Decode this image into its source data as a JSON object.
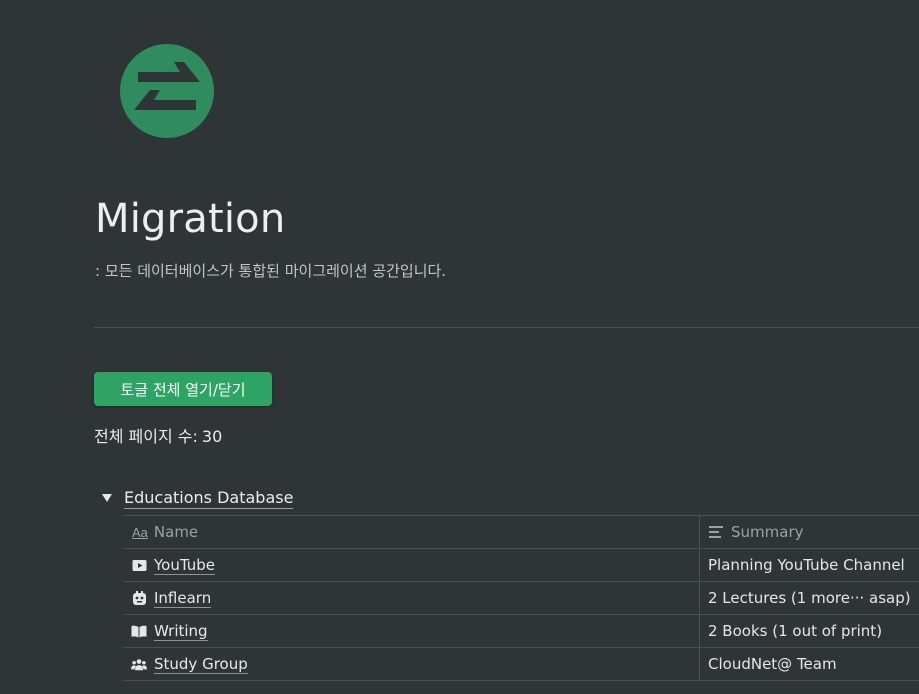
{
  "page": {
    "title": "Migration",
    "subtitle": ": 모든 데이터베이스가 통합된 마이그레이션 공간입니다.",
    "toggle_button_label": "토글 전체 열기/닫기",
    "page_count_label": "전체 페이지 수:",
    "page_count_value": "30",
    "logo_icon": "arrows-exchange-icon",
    "accent_color": "#2ea464",
    "logo_color": "#2f8c5e"
  },
  "database": {
    "title": "Educations Database",
    "toggle_state": "expanded",
    "columns": {
      "name": "Name",
      "name_icon": "Aa",
      "summary": "Summary",
      "summary_icon": "text-lines-icon"
    },
    "rows": [
      {
        "name": "YouTube",
        "icon": "play-video-icon",
        "summary": "Planning YouTube Channel"
      },
      {
        "name": "Inflearn",
        "icon": "robot-face-icon",
        "summary": "2 Lectures (1 more··· asap)"
      },
      {
        "name": "Writing",
        "icon": "open-book-icon",
        "summary": "2 Books (1 out of print)"
      },
      {
        "name": "Study Group",
        "icon": "people-group-icon",
        "summary": "CloudNet@ Team"
      }
    ]
  }
}
